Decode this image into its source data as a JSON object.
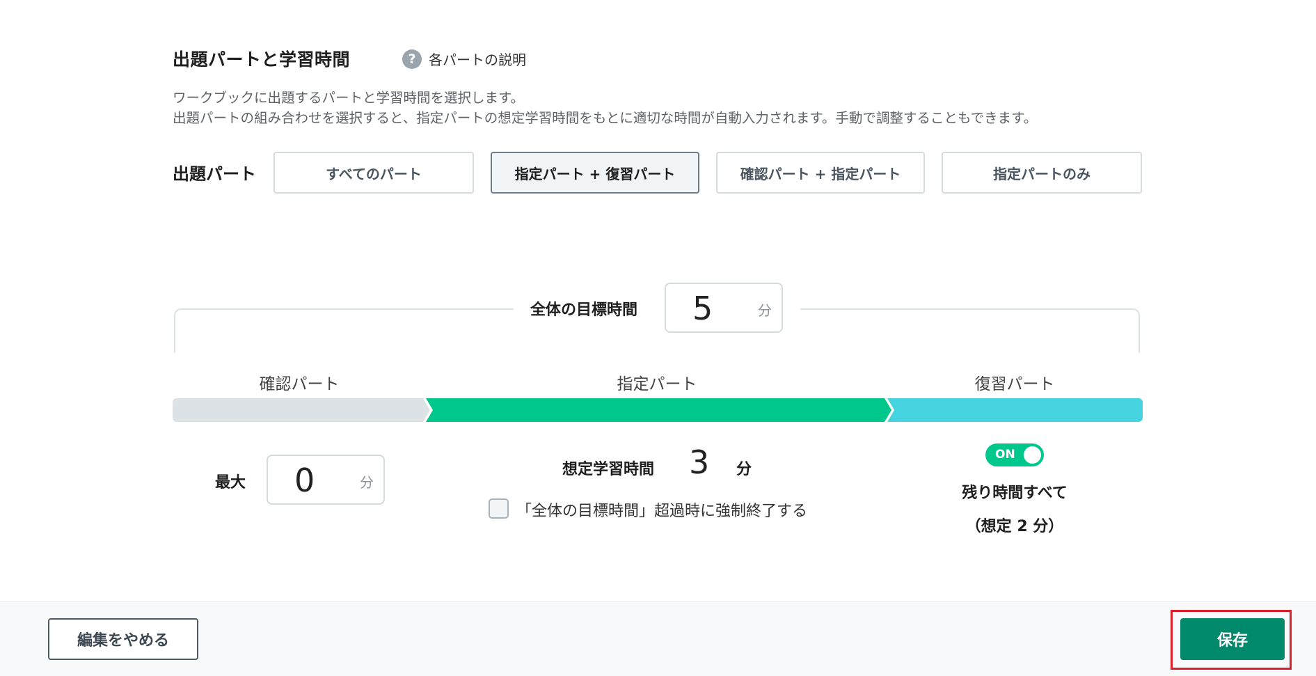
{
  "section": {
    "title": "出題パートと学習時間",
    "help_label": "各パートの説明",
    "description_line1": "ワークブックに出題するパートと学習時間を選択します。",
    "description_line2": "出題パートの組み合わせを選択すると、指定パートの想定学習時間をもとに適切な時間が自動入力されます。手動で調整することもできます。"
  },
  "part_selector": {
    "label": "出題パート",
    "options": [
      {
        "label": "すべてのパート",
        "selected": false
      },
      {
        "label": "指定パート + 復習パート",
        "selected": true
      },
      {
        "label": "確認パート + 指定パート",
        "selected": false
      },
      {
        "label": "指定パートのみ",
        "selected": false
      }
    ]
  },
  "total_target": {
    "label": "全体の目標時間",
    "value": "5",
    "unit": "分"
  },
  "segments": [
    {
      "label": "確認パート",
      "color": "#dde2e6"
    },
    {
      "label": "指定パート",
      "color": "#00c78b"
    },
    {
      "label": "復習パート",
      "color": "#45d3e0"
    }
  ],
  "confirm_part": {
    "max_label": "最大",
    "value": "0",
    "unit": "分"
  },
  "specified_part": {
    "estimate_label": "想定学習時間",
    "estimate_value": "3",
    "estimate_unit": "分",
    "force_end_label": "「全体の目標時間」超過時に強制終了する",
    "force_end_checked": false
  },
  "review_part": {
    "toggle_label": "ON",
    "toggle_on": true,
    "remaining_label": "残り時間すべて",
    "estimate_text": "（想定 2 分）"
  },
  "footer": {
    "cancel_label": "編集をやめる",
    "save_label": "保存"
  },
  "colors": {
    "primary_green": "#00896a",
    "accent_green": "#00c78b",
    "accent_cyan": "#45d3e0",
    "highlight_red": "#d9202a"
  }
}
